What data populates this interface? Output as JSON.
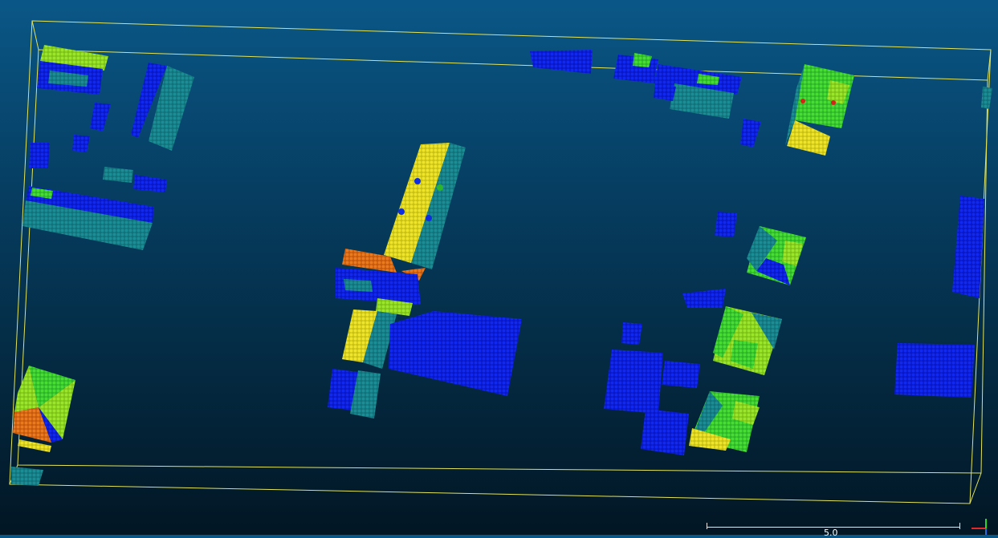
{
  "viewer": {
    "background_top": "#0a5787",
    "background_bottom": "#021624",
    "bbox_color": "#e3e35a",
    "point_colors": {
      "blue": "#0b1bd9",
      "teal": "#17848c",
      "green": "#3bd62c",
      "lime": "#8fe01e",
      "yellow": "#e2dc1f",
      "orange": "#e06a12",
      "red": "#d4241a"
    }
  },
  "scale_bar": {
    "label": "5.0"
  },
  "axis_triad": {
    "x_color": "#e02a2a",
    "y_color": "#2ad62a",
    "z_color": "#2a6ae0"
  }
}
